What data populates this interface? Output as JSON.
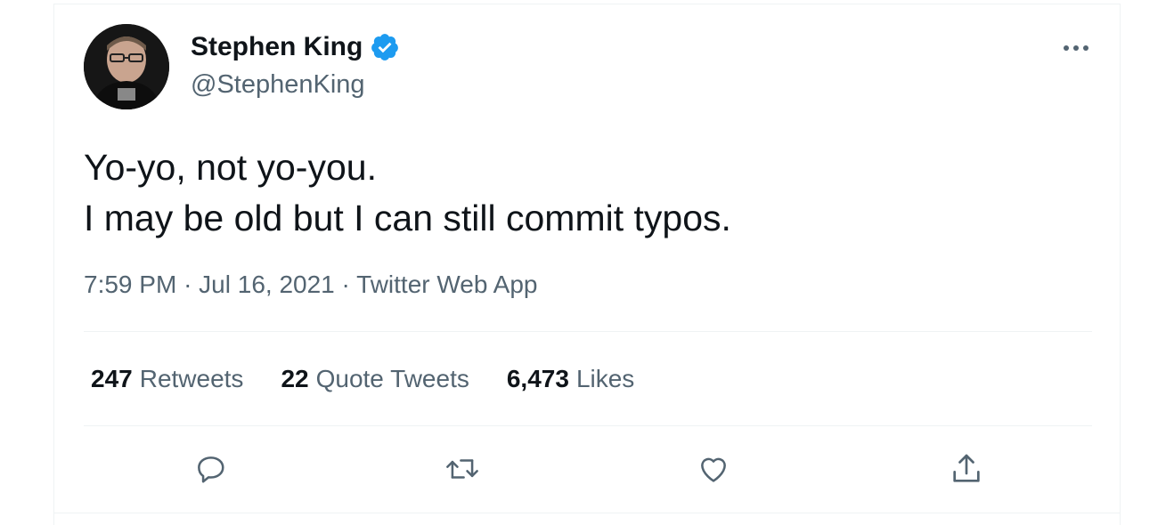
{
  "author": {
    "name": "Stephen King",
    "handle": "@StephenKing",
    "verified": true
  },
  "tweet": {
    "lines": [
      "Yo-yo, not yo-you.",
      "I may be old but I can still commit typos."
    ]
  },
  "meta": {
    "time": "7:59 PM",
    "sep1": "·",
    "date": "Jul 16, 2021",
    "sep2": "·",
    "source": "Twitter Web App"
  },
  "stats": {
    "retweets_count": "247",
    "retweets_label": "Retweets",
    "quotes_count": "22",
    "quotes_label": "Quote Tweets",
    "likes_count": "6,473",
    "likes_label": "Likes"
  },
  "actions": [
    "reply-icon",
    "retweet-icon",
    "like-icon",
    "share-icon"
  ],
  "colors": {
    "verified_blue": "#1d9bf0",
    "text_primary": "#0f1419",
    "text_secondary": "#536471",
    "divider": "#eff3f4"
  }
}
